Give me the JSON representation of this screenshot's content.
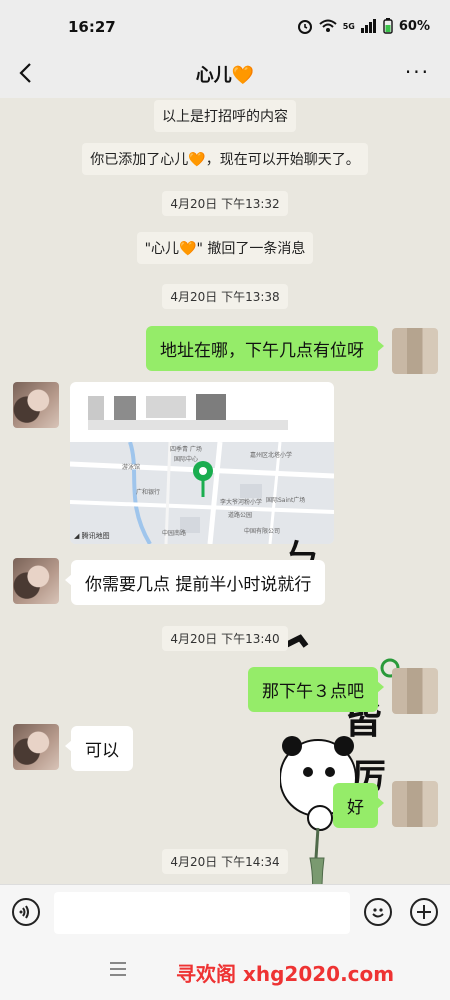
{
  "status_bar": {
    "time": "16:27",
    "battery": "60%",
    "network": "5G"
  },
  "header": {
    "title": "心儿🧡",
    "back_icon": "back-arrow-icon",
    "more_label": "···"
  },
  "chat": {
    "system_greeting": "以上是打招呼的内容",
    "system_added": "你已添加了心儿🧡，现在可以开始聊天了。",
    "timestamp1": "4月20日 下午13:32",
    "system_recall": "\"心儿🧡\" 撤回了一条消息",
    "timestamp2": "4月20日 下午13:38",
    "msg_me_1": "地址在哪，下午几点有位呀",
    "location_card": {
      "map_credit": "◢ 腾讯地图",
      "map_labels": [
        "四季青 广场",
        "嘉州区北塔小学",
        "游泳馆",
        "广和银行",
        "道路公园",
        "李大爷河粉小学",
        "中国有限公司",
        "国际Saint广场",
        "中园南路",
        "国际中心"
      ]
    },
    "msg_her_1": "你需要几点 提前半小时说就行",
    "timestamp3": "4月20日 下午13:40",
    "msg_me_2": "那下午３点吧",
    "msg_her_2": "可以",
    "msg_me_3": "好",
    "timestamp4": "4月20日 下午14:34"
  },
  "sticker": {
    "text1": "皆",
    "text2": "厉"
  },
  "input": {
    "placeholder": ""
  },
  "footer": {
    "watermark": "寻欢阁 xhg2020.com"
  },
  "colors": {
    "sent_bubble": "#95ec69",
    "received_bubble": "#ffffff",
    "chat_bg": "#e9e7df",
    "watermark": "#e33333"
  }
}
